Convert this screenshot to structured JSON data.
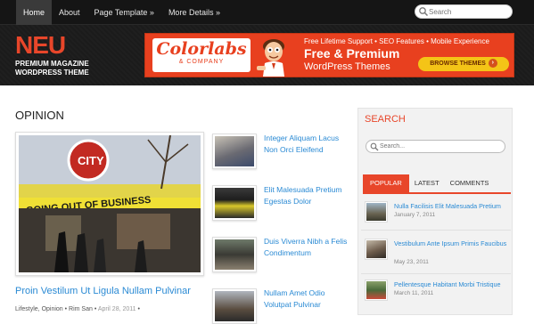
{
  "nav": {
    "items": [
      {
        "label": "Home",
        "active": true
      },
      {
        "label": "About",
        "active": false
      },
      {
        "label": "Page Template »",
        "active": false
      },
      {
        "label": "More Details »",
        "active": false
      }
    ],
    "search_placeholder": "Search"
  },
  "logo": {
    "title": "NEU",
    "tagline_1": "PREMIUM MAGAZINE",
    "tagline_2": "WORDPRESS THEME"
  },
  "banner": {
    "brand": "Colorlabs",
    "brand_sub": "& COMPANY",
    "line1": "Free Lifetime Support • SEO Features • Mobile Experience",
    "line2": "Free & Premium",
    "line3": "WordPress Themes",
    "button": "BROWSE THEMES",
    "button_arrow": "›"
  },
  "main": {
    "section_title": "OPINION",
    "featured": {
      "title": "Proin Vestilum Ut Ligula Nullam Pulvinar",
      "categories": "Lifestyle, Opinion",
      "author": "Rim San",
      "date": "April 28, 2011",
      "sep": " • "
    },
    "posts": [
      {
        "title": "Integer Aliquam Lacus Non Orci Eleifend"
      },
      {
        "title": "Elit Malesuada Pretium Egestas Dolor"
      },
      {
        "title": "Duis Viverra Nibh a Felis Condimentum"
      },
      {
        "title": "Nullam Amet Odio Volutpat Pulvinar"
      }
    ]
  },
  "sidebar": {
    "search_title": "SEARCH",
    "search_placeholder": "Search...",
    "tabs": [
      "POPULAR",
      "LATEST",
      "COMMENTS"
    ],
    "popular": [
      {
        "title": "Nulla Facilisis Elit Malesuada Pretium",
        "date": "January 7, 2011"
      },
      {
        "title": "Vestibulum Ante Ipsum Primis Faucibus",
        "date": "May 23, 2011"
      },
      {
        "title": "Pellentesque Habitant Morbi Tristique",
        "date": "March 11, 2011"
      }
    ]
  },
  "colors": {
    "accent": "#e8462a",
    "link": "#2a8ad4",
    "dark": "#151515",
    "banner": "#e8401f",
    "button": "#f4c417"
  }
}
